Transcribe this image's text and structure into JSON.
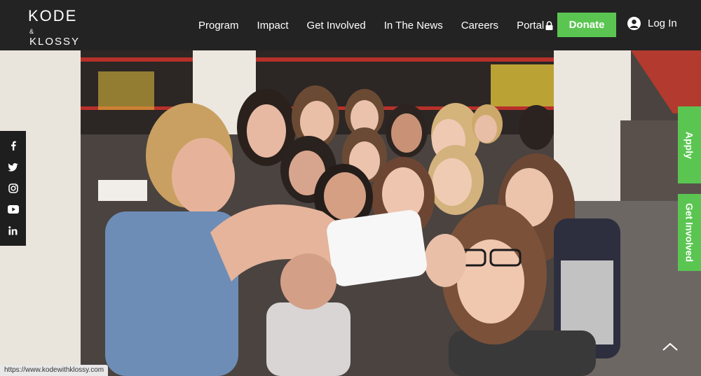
{
  "header": {
    "logo_top": "KODE",
    "logo_amp": "&",
    "logo_bottom": "KLOSSY",
    "nav": [
      "Program",
      "Impact",
      "Get Involved",
      "In The News",
      "Careers",
      "Portal"
    ],
    "donate_label": "Donate",
    "login_label": "Log In"
  },
  "hero": {
    "description_icon": "group-selfie-photo"
  },
  "social": {
    "icons": [
      "facebook-icon",
      "twitter-icon",
      "instagram-icon",
      "youtube-icon",
      "linkedin-icon"
    ]
  },
  "side_tabs": {
    "apply_label": "Apply",
    "involved_label": "Get Involved"
  },
  "status_bar": {
    "url": "https://www.kodewithklossy.com"
  },
  "colors": {
    "header_bg": "#232323",
    "accent_green": "#5ac651"
  }
}
